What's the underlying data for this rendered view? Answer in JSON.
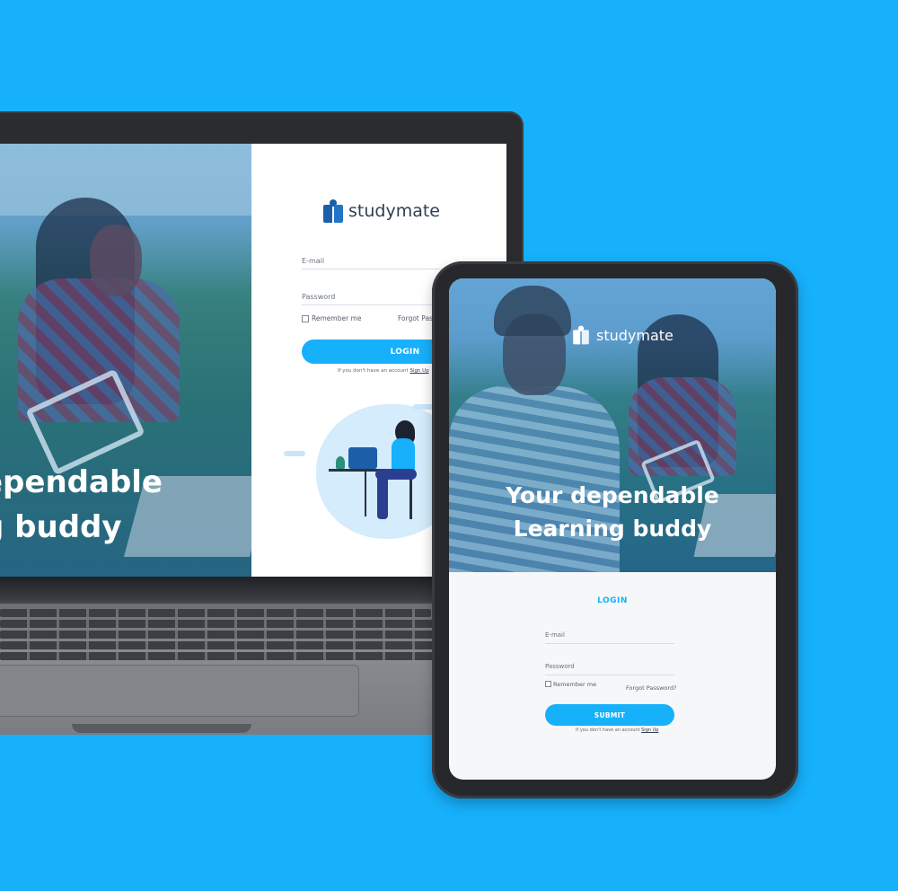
{
  "brand": {
    "name": "studymate",
    "accent": "#17b0fb",
    "logo_primary": "#1d5ea8"
  },
  "laptop": {
    "hero": {
      "line1": "ependable",
      "line2": "g buddy"
    },
    "form": {
      "email_label": "E-mail",
      "password_label": "Password",
      "remember_label": "Remember me",
      "forgot_label": "Forgot Pass",
      "button_label": "LOGIN",
      "signup_prompt": "If you don't have an account",
      "signup_link": "Sign Up"
    }
  },
  "tablet": {
    "hero": {
      "line1": "Your dependable",
      "line2": "Learning buddy"
    },
    "form": {
      "title": "LOGIN",
      "email_label": "E-mail",
      "password_label": "Password",
      "remember_label": "Remember me",
      "forgot_label": "Forgot Password?",
      "button_label": "SUBMIT",
      "signup_prompt": "If you don't have an account",
      "signup_link": "Sign Up"
    }
  }
}
